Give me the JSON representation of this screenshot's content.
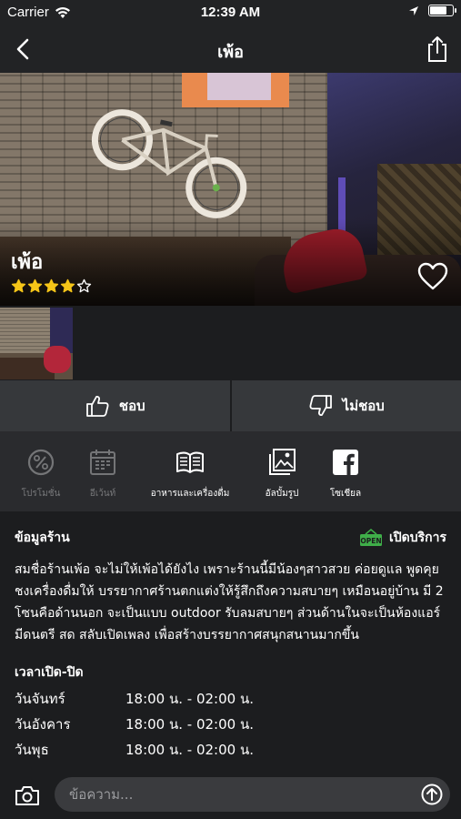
{
  "status_bar": {
    "carrier": "Carrier",
    "time": "12:39 AM",
    "battery_level": 0.8
  },
  "nav": {
    "title": "เพ้อ",
    "back_icon": "chevron-left-icon",
    "share_icon": "share-icon"
  },
  "hero": {
    "name": "เพ้อ",
    "rating": 4,
    "rating_max": 5,
    "heart_icon": "heart-outline-icon"
  },
  "gallery": {
    "thumbnails": [
      "restaurant-photo"
    ]
  },
  "reactions": {
    "like_label": "ชอบ",
    "dislike_label": "ไม่ชอบ"
  },
  "menu": {
    "items": [
      {
        "label": "โปรโมชั่น",
        "icon": "percent-icon",
        "enabled": false
      },
      {
        "label": "อีเว้นท์",
        "icon": "calendar-icon",
        "enabled": false
      },
      {
        "label": "อาหารและเครื่องดื่ม",
        "icon": "book-icon",
        "enabled": true
      },
      {
        "label": "อัลบั้มรูป",
        "icon": "photo-album-icon",
        "enabled": true
      },
      {
        "label": "โซเชียล",
        "icon": "facebook-icon",
        "enabled": true
      }
    ]
  },
  "info": {
    "title": "ข้อมูลร้าน",
    "status": "เปิดบริการ",
    "status_icon": "open-sign-icon",
    "description": "สมชื่อร้านเพ้อ จะไม่ให้เพ้อได้ยังไง เพราะร้านนี้มีน้องๆสาวสวย ค่อยดูแล พูดคุย ชงเครื่องดื่มให้ บรรยากาศร้านตกแต่งให้รู้สึกถึงความสบายๆ เหมือนอยู่บ้าน มี 2 โซนคือด้านนอก จะเป็นแบบ outdoor รับลมสบายๆ ส่วนด้านในจะเป็นห้องแอร์ มีดนตรี สด สลับเปิดเพลง เพื่อสร้างบรรยากาศสนุกสนานมากขึ้น",
    "hours_title": "เวลาเปิด-ปิด",
    "hours": [
      {
        "day": "วันจันทร์",
        "time": "18:00 น. - 02:00 น."
      },
      {
        "day": "วันอังคาร",
        "time": "18:00 น. - 02:00 น."
      },
      {
        "day": "วันพุธ",
        "time": "18:00 น. - 02:00 น."
      }
    ]
  },
  "composer": {
    "placeholder": "ข้อความ...",
    "camera_icon": "camera-icon",
    "send_icon": "send-icon"
  }
}
